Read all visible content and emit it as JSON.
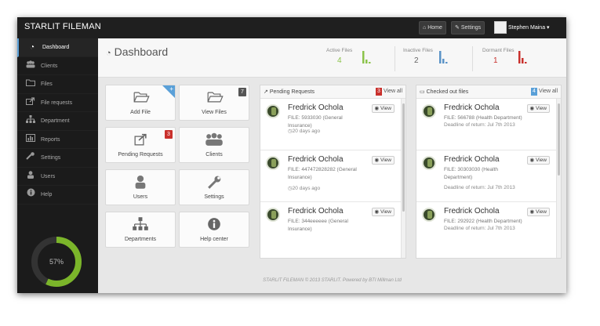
{
  "app": {
    "brand": "STARLIT FILEMAN"
  },
  "topbar": {
    "home": "Home",
    "settings": "Settings",
    "user_name": "Stephen Maina"
  },
  "sidebar": {
    "items": [
      {
        "label": "Dashboard",
        "icon": "dashboard-icon"
      },
      {
        "label": "Clients",
        "icon": "users-group-icon"
      },
      {
        "label": "Files",
        "icon": "folder-icon"
      },
      {
        "label": "File requests",
        "icon": "share-icon"
      },
      {
        "label": "Department",
        "icon": "sitemap-icon"
      },
      {
        "label": "Reports",
        "icon": "bar-chart-icon"
      },
      {
        "label": "Settings",
        "icon": "wrench-icon"
      },
      {
        "label": "Users",
        "icon": "user-icon"
      },
      {
        "label": "Help",
        "icon": "info-icon"
      }
    ],
    "gauge": {
      "label": "57%",
      "value": 0.57,
      "color": "#7bb52a"
    }
  },
  "header": {
    "title": "Dashboard",
    "stats": [
      {
        "label": "Active Files",
        "value": "4",
        "color": "#8bc34a"
      },
      {
        "label": "Inactive Files",
        "value": "2",
        "color": "#5b93c7"
      },
      {
        "label": "Dormant Files",
        "value": "1",
        "color": "#c9302c"
      }
    ]
  },
  "tiles": [
    {
      "label": "Add File",
      "icon": "folder-open-icon"
    },
    {
      "label": "View Files",
      "icon": "folder-open-icon",
      "badge": "7"
    },
    {
      "label": "Pending Requests",
      "icon": "share-icon",
      "badge": "3"
    },
    {
      "label": "Clients",
      "icon": "users-group-icon"
    },
    {
      "label": "Users",
      "icon": "user-icon"
    },
    {
      "label": "Settings",
      "icon": "wrench-icon"
    },
    {
      "label": "Departments",
      "icon": "sitemap-icon"
    },
    {
      "label": "Help center",
      "icon": "info-icon"
    }
  ],
  "pending": {
    "title": "Pending Requests",
    "badge": "3",
    "view_all": "View all",
    "rows": [
      {
        "name": "Fredrick Ochola",
        "file": "FILE: 5933030 (General Insurance)",
        "time": "20 days ago",
        "view": "View"
      },
      {
        "name": "Fredrick Ochola",
        "file": "FILE: 447472828282 (General Insurance)",
        "time": "20 days ago",
        "view": "View"
      },
      {
        "name": "Fredrick Ochola",
        "file": "FILE: 344eeeeee (General Insurance)",
        "time": "",
        "view": "View"
      }
    ]
  },
  "checked": {
    "title": "Checked out files",
    "badge": "4",
    "view_all": "View all",
    "rows": [
      {
        "name": "Fredrick Ochola",
        "file": "FILE: 566788 (Health Department)",
        "time": "Deadline of return: Jul 7th 2013",
        "view": "View"
      },
      {
        "name": "Fredrick Ochola",
        "file": "FILE: 30303030 (Health Department)",
        "time": "Deadline of return: Jul 7th 2013",
        "view": "View"
      },
      {
        "name": "Fredrick Ochola",
        "file": "FILE: 292922 (Health Department)",
        "time": "Deadline of return: Jul 7th 2013",
        "view": "View"
      }
    ]
  },
  "footer": "STARLIT FILEMAN © 2013 STARLIT. Powered by BTI Millman Ltd"
}
